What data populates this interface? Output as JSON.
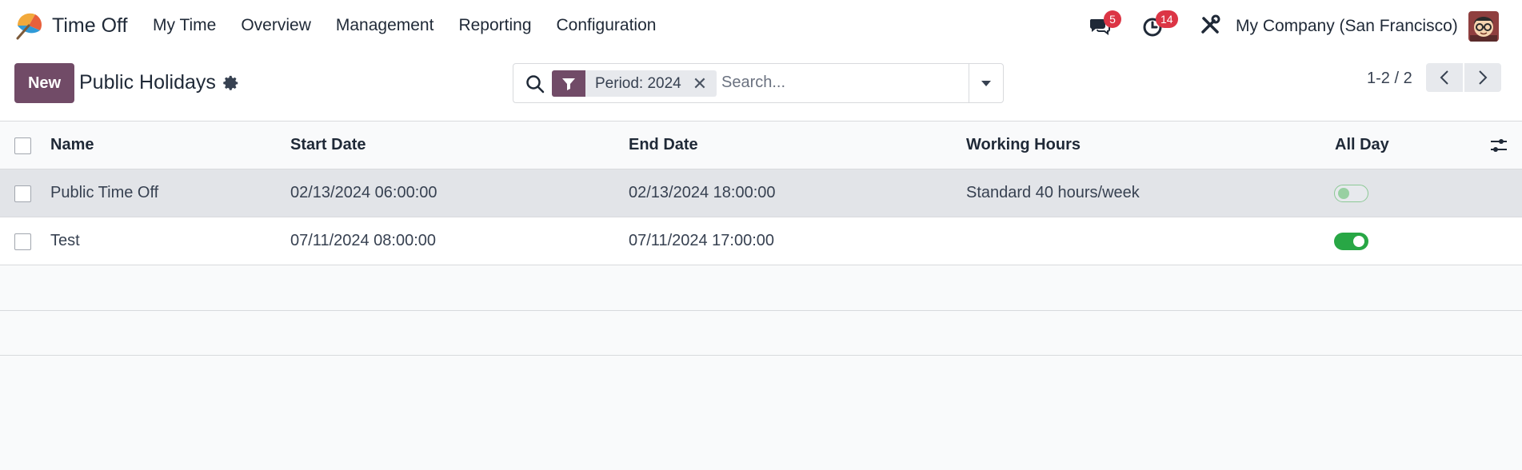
{
  "navbar": {
    "app_name": "Time Off",
    "menu": [
      "My Time",
      "Overview",
      "Management",
      "Reporting",
      "Configuration"
    ],
    "messages_count": "5",
    "activities_count": "14",
    "company": "My Company (San Francisco)"
  },
  "control_panel": {
    "new_label": "New",
    "title": "Public Holidays",
    "facet_label": "Period: 2024",
    "search_placeholder": "Search...",
    "pager": "1-2 / 2"
  },
  "table": {
    "columns": [
      "Name",
      "Start Date",
      "End Date",
      "Working Hours",
      "All Day"
    ],
    "rows": [
      {
        "name": "Public Time Off",
        "start": "02/13/2024 06:00:00",
        "end": "02/13/2024 18:00:00",
        "hours": "Standard 40 hours/week",
        "all_day": false
      },
      {
        "name": "Test",
        "start": "07/11/2024 08:00:00",
        "end": "07/11/2024 17:00:00",
        "hours": "",
        "all_day": true
      }
    ]
  },
  "colors": {
    "brand": "#714b67",
    "badge": "#dc3545",
    "toggle_on": "#28a745",
    "selected_row": "#e2e4e8"
  },
  "icons": [
    "app-logo-icon",
    "messages-icon",
    "activities-clock-icon",
    "tools-icon",
    "gear-icon",
    "search-icon",
    "filter-icon",
    "close-icon",
    "caret-down-icon",
    "chevron-left-icon",
    "chevron-right-icon",
    "optional-columns-icon"
  ]
}
